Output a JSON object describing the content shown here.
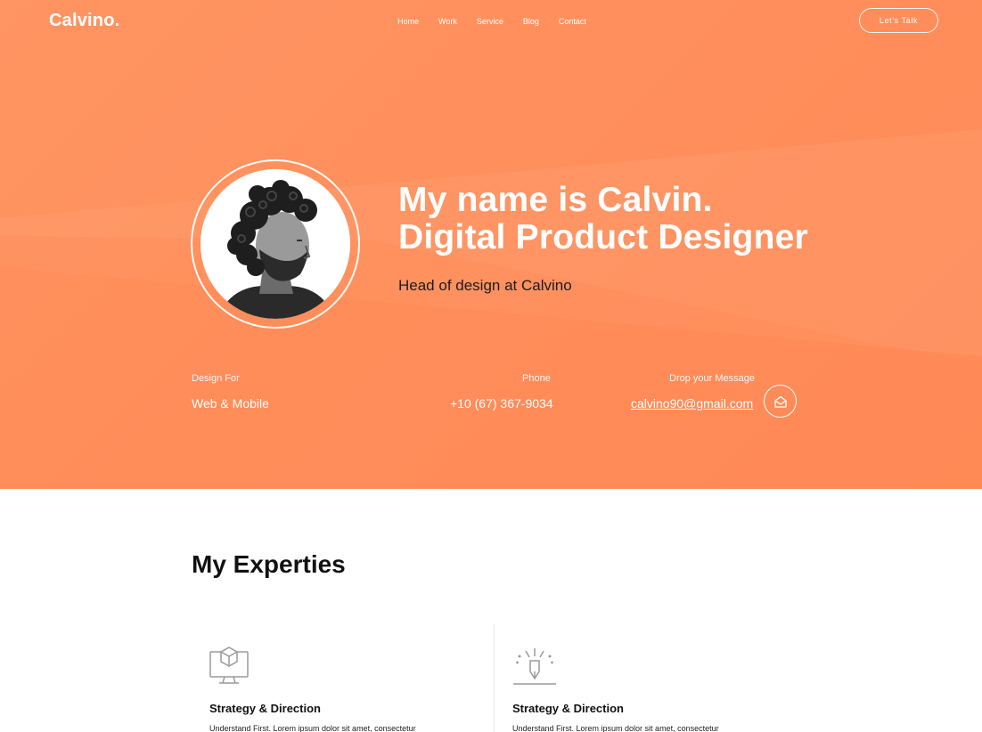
{
  "brand": {
    "logo": "Calvino."
  },
  "nav": {
    "items": [
      "Home",
      "Work",
      "Service",
      "Blog",
      "Contact"
    ]
  },
  "cta_label": "Let’s Talk",
  "hero": {
    "title_line1": "My name is Calvin.",
    "title_line2": "Digital Product Designer",
    "subtitle": "Head of design at Calvino",
    "info": [
      {
        "label": "Design For",
        "value": "Web & Mobile"
      },
      {
        "label": "Phone",
        "value": "+10 (67) 367-9034"
      },
      {
        "label": "Drop your Message",
        "value": "calvino90@gmail.com"
      }
    ],
    "message_icon": "envelope-open-icon",
    "avatar": "portrait-photo"
  },
  "expertise": {
    "title": "My Experties",
    "cards": [
      {
        "icon": "monitor-cube-icon",
        "title": "Strategy & Direction",
        "text": "Understand First. Lorem ipsum dolor sit amet, consectetur"
      },
      {
        "icon": "pen-sparkle-icon",
        "title": "Strategy & Direction",
        "text": "Understand First. Lorem ipsum dolor sit amet, consectetur"
      }
    ]
  },
  "colors": {
    "hero_bg": "#ff8f5c",
    "text_dark": "#111111",
    "white": "#ffffff"
  }
}
